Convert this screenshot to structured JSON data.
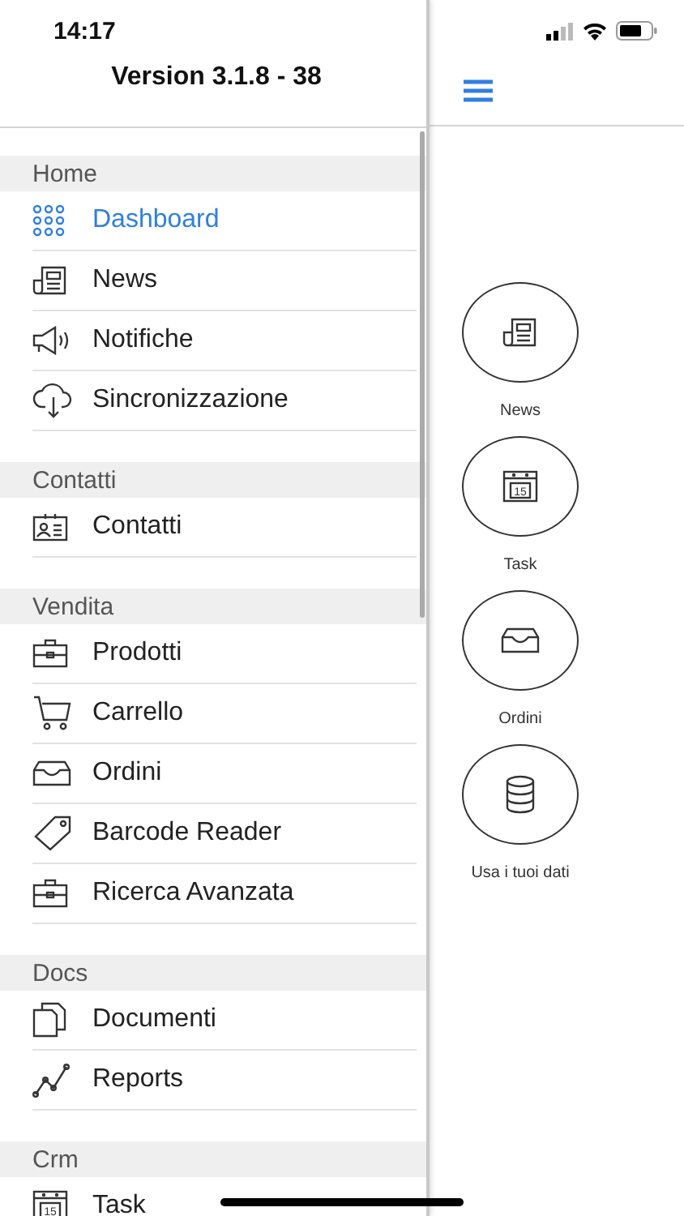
{
  "status_bar": {
    "time": "14:17"
  },
  "menu": {
    "title": "Version 3.1.8 - 38",
    "sections": [
      {
        "header": "Home",
        "items": [
          {
            "label": "Dashboard",
            "selected": true
          },
          {
            "label": "News",
            "selected": false
          },
          {
            "label": "Notifiche",
            "selected": false
          },
          {
            "label": "Sincronizzazione",
            "selected": false
          }
        ]
      },
      {
        "header": "Contatti",
        "items": [
          {
            "label": "Contatti",
            "selected": false
          }
        ]
      },
      {
        "header": "Vendita",
        "items": [
          {
            "label": "Prodotti",
            "selected": false
          },
          {
            "label": "Carrello",
            "selected": false
          },
          {
            "label": "Ordini",
            "selected": false
          },
          {
            "label": "Barcode Reader",
            "selected": false
          },
          {
            "label": "Ricerca Avanzata",
            "selected": false
          }
        ]
      },
      {
        "header": "Docs",
        "items": [
          {
            "label": "Documenti",
            "selected": false
          },
          {
            "label": "Reports",
            "selected": false
          }
        ]
      },
      {
        "header": "Crm",
        "items": [
          {
            "label": "Task",
            "selected": false,
            "icon_label": "15"
          }
        ]
      }
    ]
  },
  "shortcuts": [
    {
      "label": "News"
    },
    {
      "label": "Task",
      "icon_label": "15"
    },
    {
      "label": "Ordini"
    },
    {
      "label": "Usa i tuoi dati"
    }
  ]
}
